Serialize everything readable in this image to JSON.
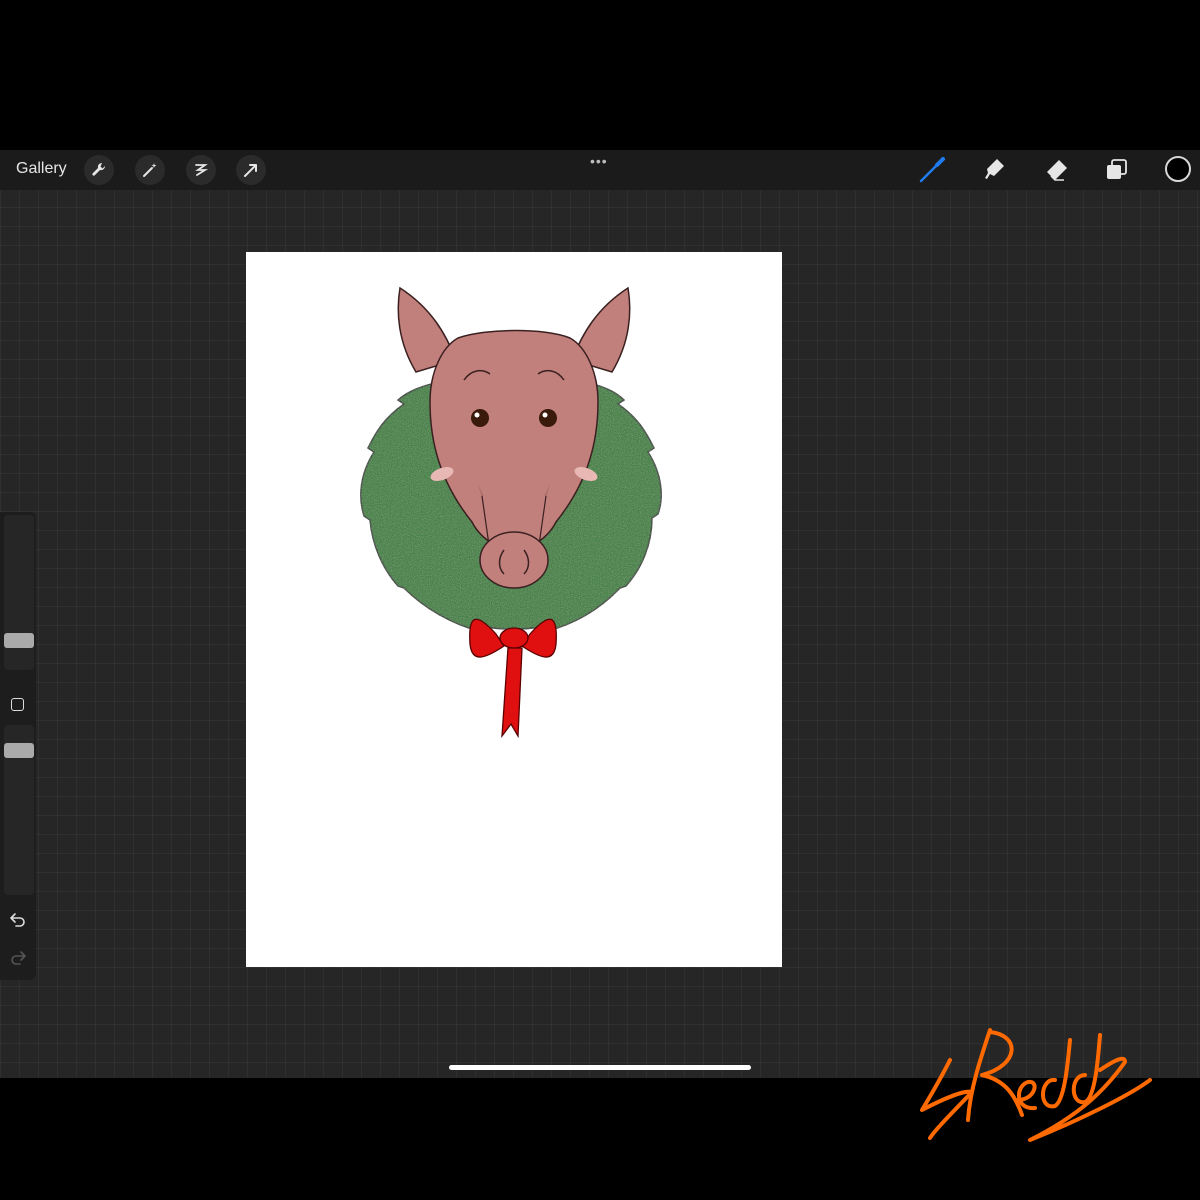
{
  "toolbar": {
    "gallery_label": "Gallery",
    "left_tools": [
      "wrench-icon",
      "magic-wand-icon",
      "selection-icon",
      "transform-arrow-icon"
    ],
    "more_label": "•••",
    "right_tools": [
      "brush-icon",
      "smudge-icon",
      "eraser-icon",
      "layers-icon"
    ],
    "active_tool": "brush-icon",
    "active_color": "#000000",
    "brush_accent": "#1e7cf0"
  },
  "sidebar": {
    "controls": [
      "brush-size-slider",
      "modify-button",
      "opacity-slider",
      "undo-icon",
      "redo-icon"
    ]
  },
  "artwork": {
    "subject": "pig-head-with-wreath",
    "colors": {
      "skin": "#c2807c",
      "wreath": "#1f7a1f",
      "bow": "#e01010",
      "eyes": "#3a1a0a"
    }
  },
  "signature": {
    "color": "#ff6a00"
  }
}
